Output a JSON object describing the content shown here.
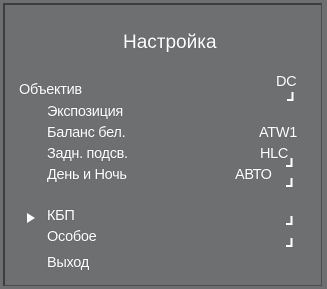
{
  "menu": {
    "title": "Настройка",
    "items": [
      {
        "label": "Объектив",
        "value": "DC",
        "submenu": true
      },
      {
        "label": "Экспозиция",
        "value": "",
        "submenu": false
      },
      {
        "label": "Баланс бел.",
        "value": "ATW1",
        "submenu": false
      },
      {
        "label": "Задн. подсв.",
        "value": "HLC",
        "submenu": true
      },
      {
        "label": "День и Ночь",
        "value": "АВТО",
        "submenu": true
      },
      {
        "label": "КБП",
        "value": "",
        "submenu": true,
        "selected": true
      },
      {
        "label": "Особое",
        "value": "",
        "submenu": true
      },
      {
        "label": "Выход",
        "value": "",
        "submenu": false
      }
    ]
  },
  "icons": {
    "submenu": "enter-icon",
    "cursor": "triangle-right-icon"
  },
  "colors": {
    "background": "#6d6f71",
    "text": "#ffffff"
  }
}
